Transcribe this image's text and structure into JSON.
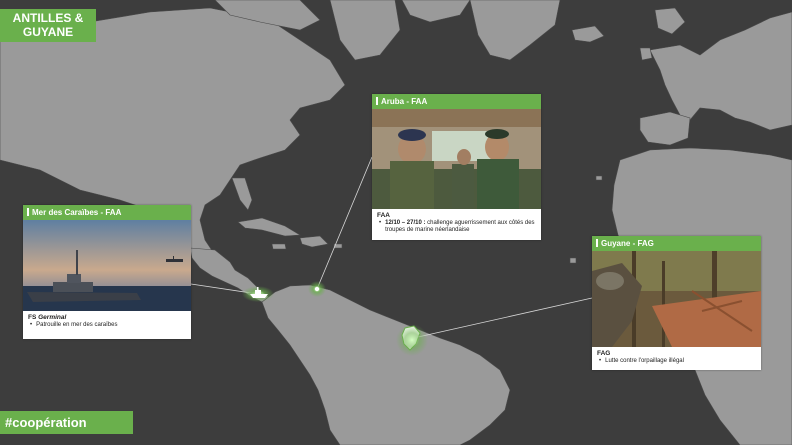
{
  "title": {
    "line1": "ANTILLES &",
    "line2": "GUYANE"
  },
  "hashtag": "#coopération",
  "colors": {
    "accent": "#6ab04c",
    "land": "#9a9a9a",
    "sea": "#3d3d3d",
    "highlight": "#ffffff"
  },
  "cards": {
    "caraibes": {
      "header": "Mer des Caraïbes - FAA",
      "label_prefix": "FS ",
      "label_italic": "Germinal",
      "bullet": "Patrouille en mer des caraïbes"
    },
    "aruba": {
      "header": "Aruba - FAA",
      "label": "FAA",
      "bullet_bold": "12/10 – 27/10 :",
      "bullet": " challenge aguerrissement aux côtés des troupes de marine néerlandaise"
    },
    "guyane": {
      "header": "Guyane - FAG",
      "label": "FAG",
      "bullet": "Lutte contre l'orpaillage illégal"
    }
  },
  "markers": [
    {
      "name": "ship-icon",
      "place": "Mer des Caraïbes"
    },
    {
      "name": "aruba-marker",
      "place": "Aruba"
    },
    {
      "name": "guyane-marker",
      "place": "Guyane"
    }
  ]
}
